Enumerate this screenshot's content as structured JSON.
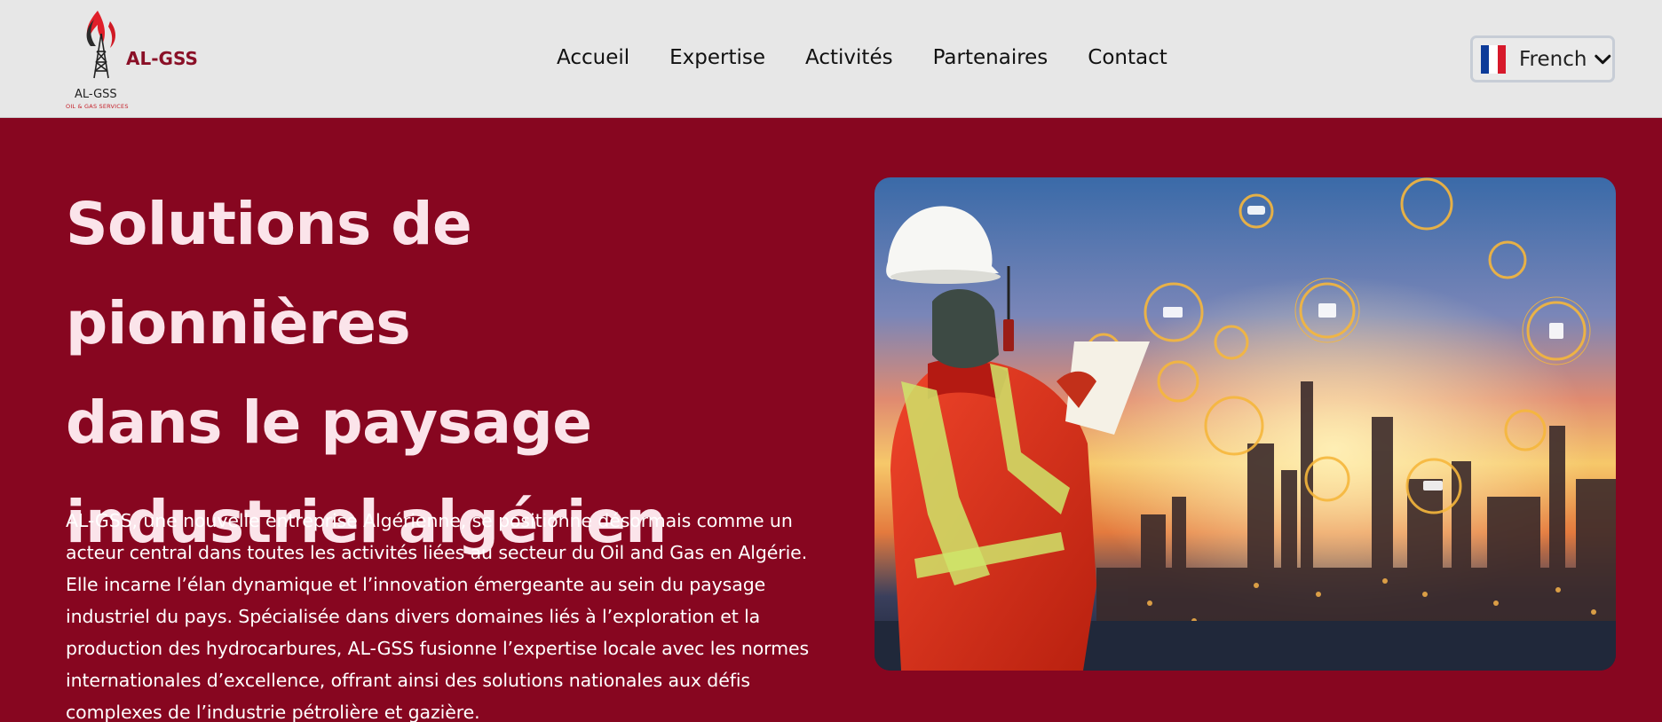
{
  "header": {
    "logo": {
      "brand": "AL-GSS",
      "subtitle": "AL-GSS",
      "tagline": "OIL & GAS SERVICES",
      "icon": "oil-derrick-flame-icon"
    },
    "nav": {
      "items": [
        {
          "label": "Accueil"
        },
        {
          "label": "Expertise"
        },
        {
          "label": "Activités"
        },
        {
          "label": "Partenaires"
        },
        {
          "label": "Contact"
        }
      ]
    },
    "language": {
      "label": "French",
      "flag_icon": "france-flag-icon",
      "chevron_icon": "chevron-down-icon"
    }
  },
  "hero": {
    "title_lines": [
      "Solutions de pionnières",
      "dans le paysage",
      "industriel algérien"
    ],
    "paragraph_lines": [
      "AL-GSS, une nouvelle entreprise Algérienne, se positionne désormais comme un",
      "acteur central dans toutes les activités liées au secteur du Oil and Gas en Algérie.",
      "Elle incarne l’élan dynamique et l’innovation émergeante au sein du paysage",
      "industriel du pays. Spécialisée dans divers domaines liés à l’exploration et la",
      "production des hydrocarbures, AL-GSS fusionne l’expertise locale avec les normes",
      "internationales d’excellence, offrant ainsi des solutions nationales aux défis",
      "complexes de l’industrie pétrolière et gazière."
    ],
    "image": "worker-refinery-photo"
  },
  "colors": {
    "background": "#870620",
    "header_bg": "#e7e7e7",
    "title": "#fbe4ea",
    "brand": "#8a1027",
    "flag_blue": "#0d3b99",
    "flag_white": "#ffffff",
    "flag_red": "#d7192b"
  }
}
